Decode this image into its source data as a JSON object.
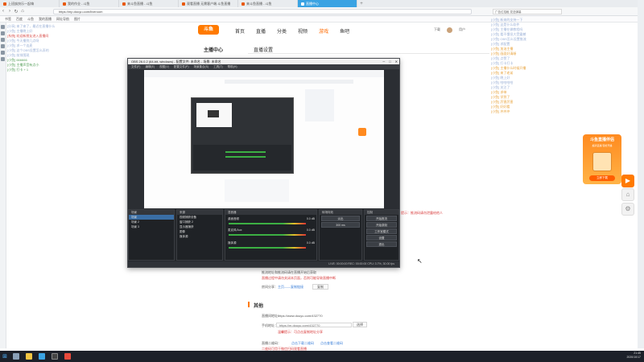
{
  "browser": {
    "tabs": [
      {
        "label": "上班族快乐一起嗨"
      },
      {
        "label": "我的作业 - 斗鱼"
      },
      {
        "label": "来斗鱼直播 - 斗鱼"
      },
      {
        "label": "观看直播 无需客户端 斗鱼直播"
      },
      {
        "label": "来斗鱼直播 - 斗鱼"
      },
      {
        "label": "直播中心"
      }
    ],
    "tab_add": "+",
    "window_controls": [
      "─",
      "□",
      "✕"
    ],
    "url": "https://mp.douyu.com/liveroom",
    "bookmarks": [
      "书签",
      "百度",
      "斗鱼",
      "我的直播",
      "网址导航",
      "图片"
    ]
  },
  "left_chat": [
    {
      "text": "[分享] 来了来了，最近在直播什么",
      "tone": "blue"
    },
    {
      "text": "[小鱼] 主播晚上好",
      "tone": "blue"
    },
    {
      "text": "[系统] 欢迎新朋友进入直播间",
      "tone": "red"
    },
    {
      "text": "[小鱼] 今天播到几点呀",
      "tone": "blue"
    },
    {
      "text": "[小鱼] 求一个连麦",
      "tone": "blue"
    },
    {
      "text": "[小鱼] 这个OBS设置怎么弄的",
      "tone": "blue"
    },
    {
      "text": "[小鱼] 前排围观",
      "tone": "blue"
    },
    {
      "text": "[小鱼] 666666",
      "tone": "green"
    },
    {
      "text": "[小鱼] 主播声音有点小",
      "tone": "green"
    },
    {
      "text": "[小鱼] 打卡 + 1",
      "tone": "green"
    }
  ],
  "site": {
    "logo": "斗鱼",
    "nav": [
      {
        "label": "首页",
        "active": false
      },
      {
        "label": "直播",
        "active": false
      },
      {
        "label": "分类",
        "active": false
      },
      {
        "label": "视频",
        "active": false
      },
      {
        "label": "游戏",
        "active": true
      },
      {
        "label": "鱼吧",
        "active": false
      }
    ],
    "header_right": {
      "download": "下载",
      "user": "用户"
    },
    "sidenav_title": "主播中心",
    "main_title": "直播设置"
  },
  "obs": {
    "title": "OBS 26.0.2 (64-bit, windows) - 配置文件: 未命名 - 场景: 未命名",
    "menu": [
      "文件(F)",
      "编辑(E)",
      "视图(V)",
      "配置文件(P)",
      "场景集合(S)",
      "工具(T)",
      "帮助(H)"
    ],
    "scenes_title": "场景",
    "scenes": [
      "场景",
      "场景 2",
      "场景 3"
    ],
    "sources_title": "来源",
    "sources": [
      "视频捕获设备",
      "窗口捕获 2",
      "显示器捕获",
      "图像",
      "媒体源"
    ],
    "mixer_title": "混音器",
    "mixer": [
      {
        "name": "桌面音频",
        "db": "0.0 dB"
      },
      {
        "name": "麦克风/Aux",
        "db": "0.0 dB"
      },
      {
        "name": "媒体源",
        "db": "0.0 dB"
      }
    ],
    "transitions_title": "转场特效",
    "transition": "淡出",
    "duration": "300 ms",
    "controls_title": "控制",
    "controls": [
      "开始推流",
      "开始录制",
      "工作室模式",
      "设置",
      "退出"
    ],
    "status": "LIVE: 00:00:00   REC: 00:00:00   CPU: 3.7%, 30.00 fps"
  },
  "page_lines": {
    "notice_red": "提示：推流码请勿泄露给他人",
    "hint_line1": "推流地址和推流码请在直播开始后获取",
    "hint_red": "直播过程中请勿关闭本页面，否则可能导致直播中断",
    "share_label": "房间分享：",
    "share_link": "主页——复制链接",
    "share_btn": "复制"
  },
  "section": {
    "title": "其他",
    "room_label": "直播间地址：",
    "room_value": "https://www.douyu.com/432770",
    "mobile_label": "手机地址：",
    "mobile_value": "https://m.douyu.com/432770",
    "mobile_select": "选择",
    "mobile_hint": "温馨提示：可点击复制地址分享",
    "qr_label": "直播二维码：",
    "qr_link1": "点击下载二维码",
    "qr_link2": "点击查看二维码",
    "footer_hint": "二维码可用于微信扫码观看直播"
  },
  "right_chat": {
    "input_placeholder": "广告位招租 发送弹幕",
    "messages": [
      {
        "text": "[小鱼] 新来的支持一下",
        "tone": "blue"
      },
      {
        "text": "[小鱼] 这是什么软件",
        "tone": "blue"
      },
      {
        "text": "[小鱼] 主播在做教程吗",
        "tone": "blue"
      },
      {
        "text": "[小鱼] 看不懂但大受震撼",
        "tone": "blue"
      },
      {
        "text": "[小鱼] OBS怎么设置推流",
        "tone": "blue"
      },
      {
        "text": "[小鱼] 求配置",
        "tone": "blue"
      },
      {
        "text": "[小鱼] 加油主播",
        "tone": "orange"
      },
      {
        "text": "[小鱼] 画面好清晰",
        "tone": "orange"
      },
      {
        "text": "[小鱼] 点赞了",
        "tone": "blue"
      },
      {
        "text": "[小鱼] 打卡打卡",
        "tone": "blue"
      },
      {
        "text": "[小鱼] 主播什么时候开播",
        "tone": "orange"
      },
      {
        "text": "[小鱼] 来了老弟",
        "tone": "orange"
      },
      {
        "text": "[小鱼] 晚上好",
        "tone": "blue"
      },
      {
        "text": "[小鱼] 哈哈哈哈",
        "tone": "blue"
      },
      {
        "text": "[小鱼] 关注了",
        "tone": "blue"
      },
      {
        "text": "[小鱼] 求带",
        "tone": "orange"
      },
      {
        "text": "[小鱼] 学到了",
        "tone": "orange"
      },
      {
        "text": "[小鱼] 厉害厉害",
        "tone": "orange"
      },
      {
        "text": "[小鱼] 好好看",
        "tone": "orange"
      },
      {
        "text": "[小鱼] 冲冲冲",
        "tone": "orange"
      }
    ]
  },
  "promo": {
    "title": "斗鱼直播伴侣",
    "subtitle": "超清直播 轻松开播",
    "button": "立即下载"
  },
  "taskbar": {
    "time": "21:45",
    "date": "2020/10/17"
  },
  "colors": {
    "brand_orange": "#ff7a00",
    "tab_active": "#3aa3e3",
    "obs_bg": "#2b2e33"
  }
}
